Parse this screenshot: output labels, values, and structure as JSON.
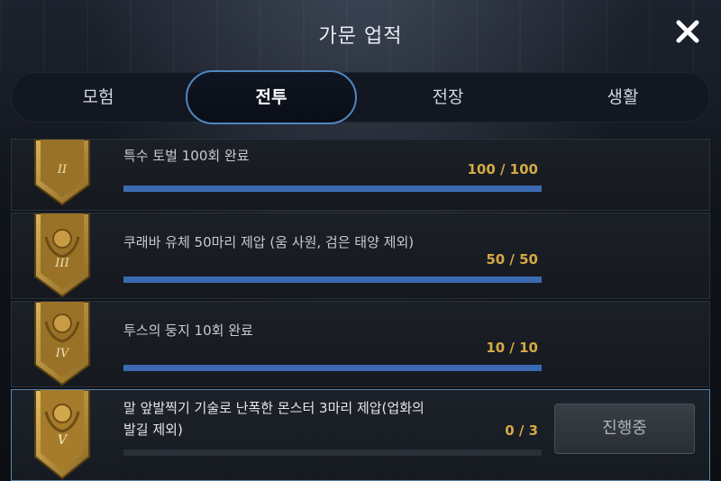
{
  "header": {
    "title": "가문 업적",
    "close_icon": "close-icon"
  },
  "tabs": [
    {
      "label": "모험",
      "active": false
    },
    {
      "label": "전투",
      "active": true
    },
    {
      "label": "전장",
      "active": false
    },
    {
      "label": "생활",
      "active": false
    }
  ],
  "achievements": [
    {
      "rank": "II",
      "text": "특수 토벌 100회 완료",
      "count": "100 / 100",
      "progress": 1.0
    },
    {
      "rank": "III",
      "text": "쿠래바 유체 50마리 제압 (움 사원, 검은 태양 제외)",
      "count": "50 / 50",
      "progress": 1.0
    },
    {
      "rank": "IV",
      "text": "투스의 둥지 10회 완료",
      "count": "10 / 10",
      "progress": 1.0
    },
    {
      "rank": "V",
      "text_line1": "말 앞발찍기 기술로 난폭한 몬스터 3마리 제압(업화의",
      "text_line2": "발길 제외)",
      "count": "0 / 3",
      "progress": 0.0,
      "status": "진행중"
    }
  ],
  "colors": {
    "accent": "#4f86c0",
    "gold": "#d4aa44",
    "bar": "#3c6ab2"
  }
}
